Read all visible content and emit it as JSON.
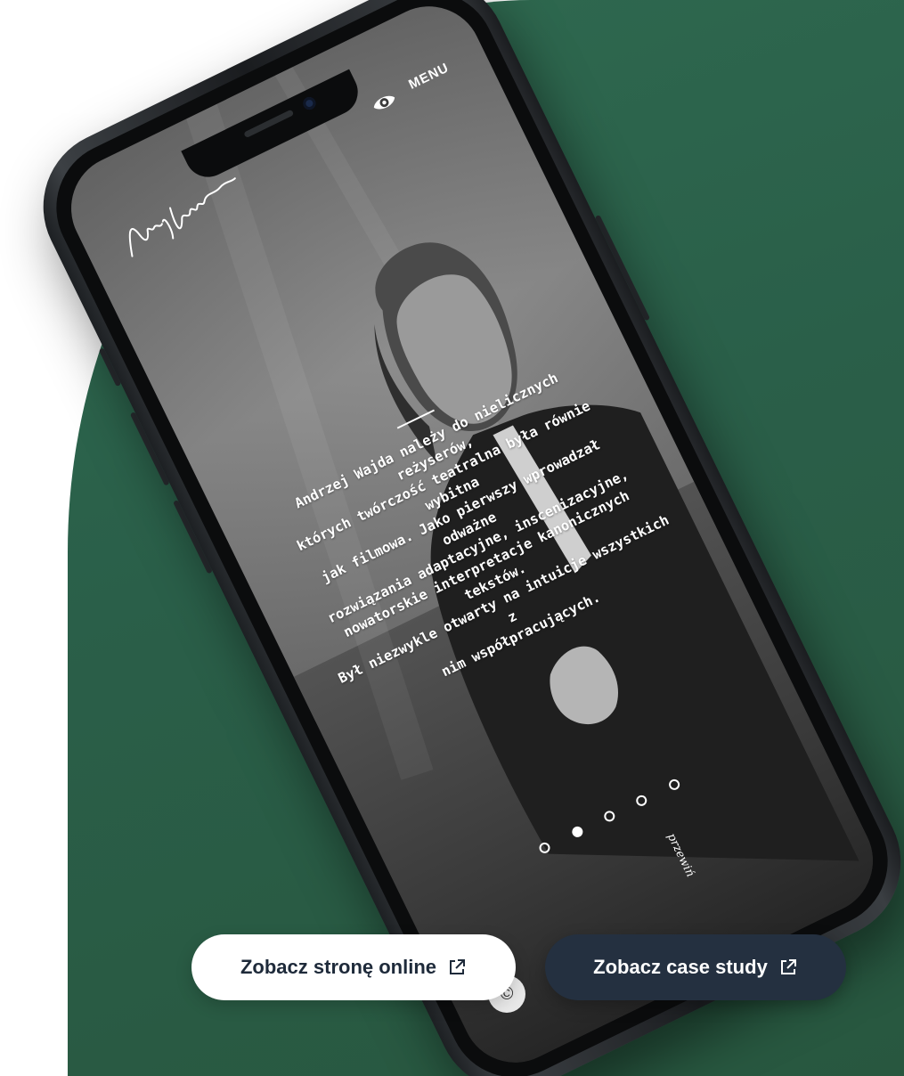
{
  "header": {
    "menu_label": "MENU",
    "signature_icon": "signature-logo",
    "view_icon": "eye-icon"
  },
  "hero": {
    "bio_lines": [
      "Andrzej Wajda należy do nielicznych reżyserów,",
      "których twórczość teatralna była równie wybitna",
      "jak filmowa. Jako pierwszy wprowadzał odważne",
      "rozwiązania adaptacyjne, inscenizacyjne,",
      "nowatorskie interpretacje kanonicznych tekstów.",
      "Był niezwykle otwarty na intuicje wszystkich z",
      "nim współpracujących."
    ]
  },
  "slider": {
    "dots": [
      "1",
      "2",
      "3",
      "4",
      "5"
    ],
    "active_index": 1
  },
  "scroll_hint": {
    "label": "przewiń"
  },
  "actions": {
    "online_label": "Zobacz stronę online",
    "case_label": "Zobacz case study",
    "external_icon": "external-link-icon"
  },
  "badge": {
    "copyright_symbol": "©"
  },
  "colors": {
    "backdrop": "#2f6a50",
    "case_button": "#243040",
    "online_button": "#ffffff"
  }
}
